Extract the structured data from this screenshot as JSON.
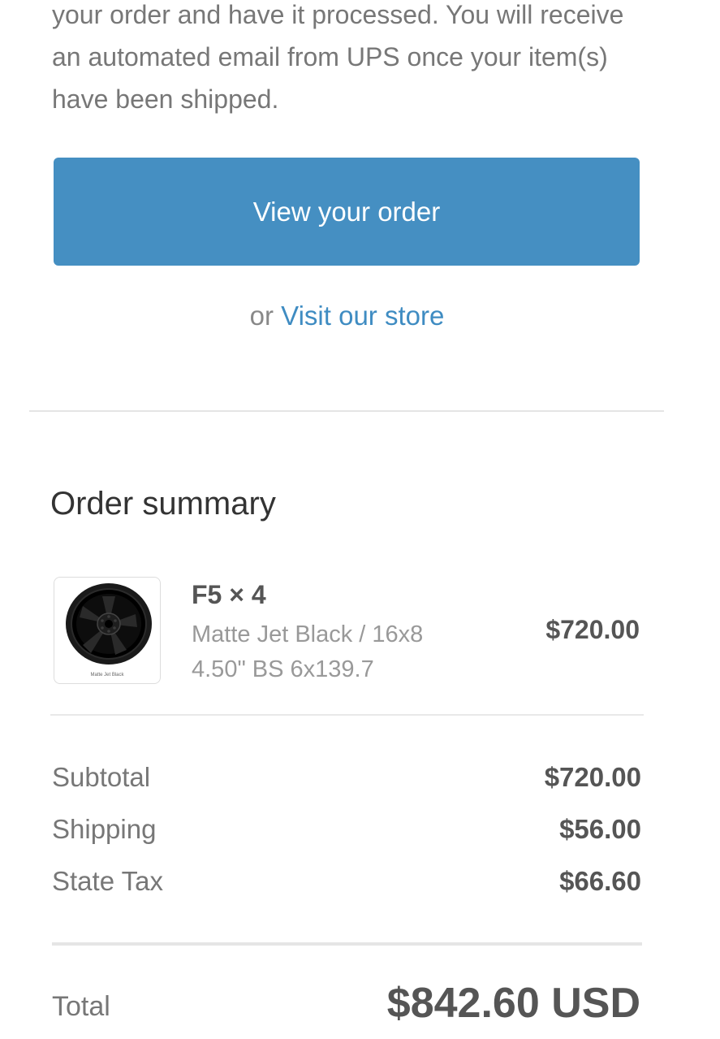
{
  "intro": {
    "text": "your order and have it processed. You will receive an automated email from UPS once your item(s) have been shipped."
  },
  "actions": {
    "view_order_label": "View your order",
    "or_text": "or",
    "visit_store_label": "Visit our store"
  },
  "colors": {
    "button": "#458fc2",
    "link": "#3f8cc2"
  },
  "summary": {
    "title": "Order summary",
    "items": [
      {
        "name": "F5 × 4",
        "variant": "Matte Jet Black / 16x8 4.50\" BS 6x139.7",
        "price": "$720.00",
        "image_caption": "Matte Jet Black",
        "image_icon": "black-wheel-image"
      }
    ],
    "lines": [
      {
        "label": "Subtotal",
        "value": "$720.00"
      },
      {
        "label": "Shipping",
        "value": "$56.00"
      },
      {
        "label": "State Tax",
        "value": "$66.60"
      }
    ],
    "total_label": "Total",
    "total_value": "$842.60 USD"
  }
}
